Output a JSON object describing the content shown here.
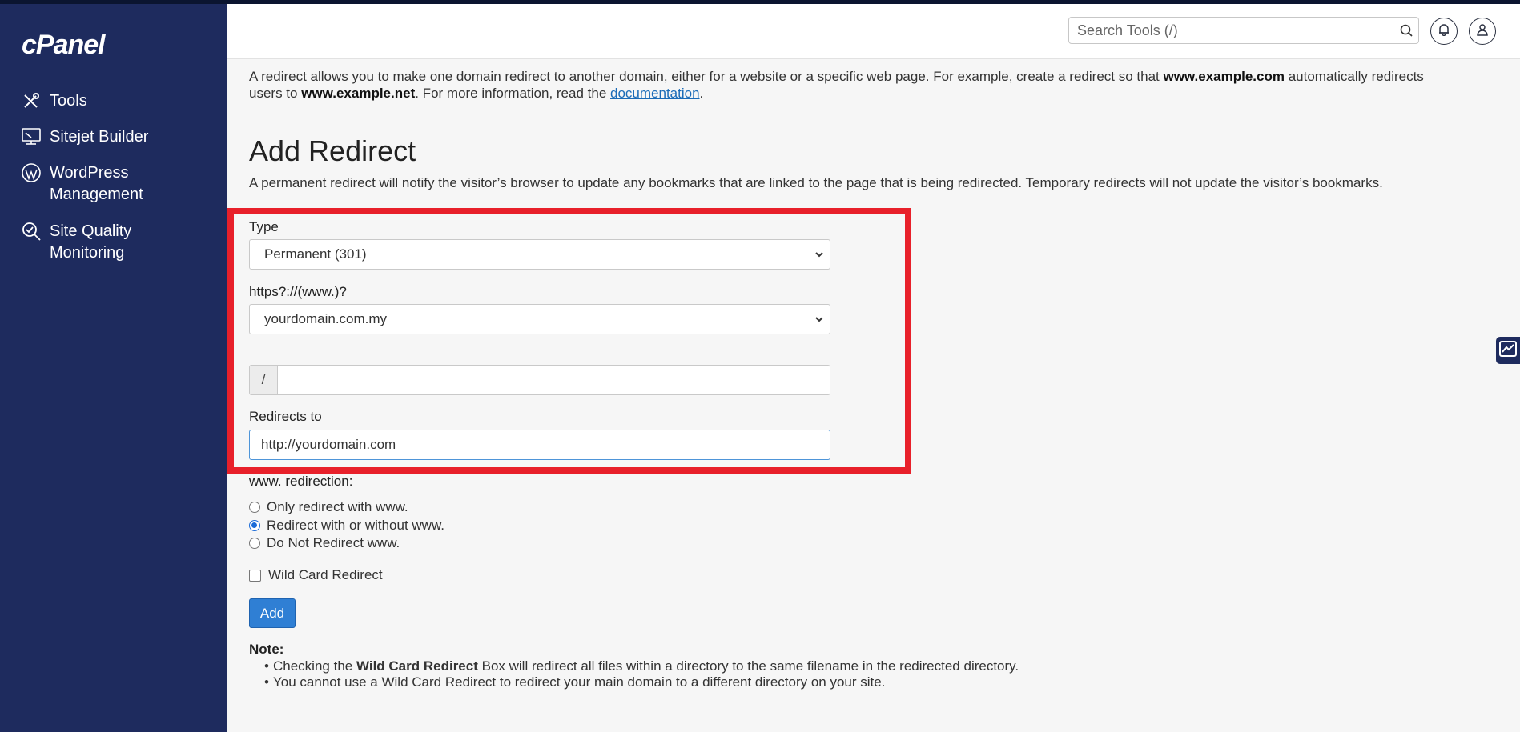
{
  "sidebar": {
    "logo": "cPanel",
    "items": [
      {
        "label": "Tools",
        "icon": "tools-icon"
      },
      {
        "label": "Sitejet Builder",
        "icon": "monitor-icon"
      },
      {
        "label_line1": "WordPress",
        "label_line2": "Management",
        "icon": "wordpress-icon"
      },
      {
        "label_line1": "Site Quality",
        "label_line2": "Monitoring",
        "icon": "magnifier-check-icon"
      }
    ]
  },
  "header": {
    "search_placeholder": "Search Tools (/)"
  },
  "intro": {
    "part1": "A redirect allows you to make one domain redirect to another domain, either for a website or a specific web page. For example, create a redirect so that ",
    "example_com": "www.example.com",
    "part2": " automatically redirects users to ",
    "example_net": "www.example.net",
    "part3": ". For more information, read the ",
    "link": "documentation",
    "part4": "."
  },
  "form": {
    "title": "Add Redirect",
    "description": "A permanent redirect will notify the visitor’s browser to update any bookmarks that are linked to the page that is being redirected. Temporary redirects will not update the visitor’s bookmarks.",
    "type_label": "Type",
    "type_value": "Permanent (301)",
    "domain_label": "https?://(www.)?",
    "domain_value": "yourdomain.com.my",
    "path_prefix": "/",
    "path_value": "",
    "redirects_label": "Redirects to",
    "redirects_value": "http://yourdomain.com",
    "www_label": "www. redirection:",
    "www_options": [
      "Only redirect with www.",
      "Redirect with or without www.",
      "Do Not Redirect www."
    ],
    "www_selected": "Redirect with or without www.",
    "wildcard_label": "Wild Card Redirect",
    "wildcard_checked": false,
    "add_label": "Add"
  },
  "note": {
    "title": "Note:",
    "item1_pre": "Checking the ",
    "item1_bold": "Wild Card Redirect",
    "item1_post": " Box will redirect all files within a directory to the same filename in the redirected directory.",
    "item2": "You cannot use a Wild Card Redirect to redirect your main domain to a different directory on your site."
  },
  "colors": {
    "sidebar": "#1e2b5e",
    "accent": "#2f7fd4",
    "highlight": "#e8202a"
  }
}
